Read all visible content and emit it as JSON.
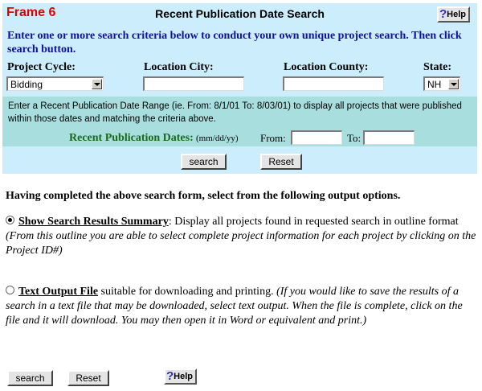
{
  "header": {
    "frame_label": "Frame 6",
    "title": "Recent Publication Date Search",
    "help_label": "Help",
    "help_icon": "question-mark-icon"
  },
  "search": {
    "instructions": "Enter one or more search criteria below to conduct your own unique project search. Then click search button.",
    "project_cycle_label": "Project Cycle:",
    "project_cycle_value": "Bidding",
    "location_city_label": "Location City:",
    "location_city_value": "",
    "location_county_label": "Location County:",
    "location_county_value": "",
    "state_label": "State:",
    "state_value": "NH",
    "date_range_instructions": "Enter a Recent Publication Date Range (ie. From: 8/1/01 To: 8/03/01) to display all projects that were published within those dates and matching the criteria above.",
    "recent_dates_label": "Recent Publication Dates:",
    "date_format": "(mm/dd/yy)",
    "from_label": "From:",
    "from_value": "",
    "to_label": "To:",
    "to_value": "",
    "search_button": "search",
    "reset_button": "Reset"
  },
  "output": {
    "heading": "Having completed the above search form, select from the following output options.",
    "summary_label": "Show Search Results Summary",
    "summary_desc": ": Display all projects found in requested search in outline format",
    "summary_note": "(From this outline you are able to select complete project information for each project by clicking on the Project ID#)",
    "summary_selected": true,
    "text_label": "Text Output File",
    "text_desc": " suitable for downloading and printing. ",
    "text_note": "(If you would like to save the results of a search in a text file that may be downloaded, select text output.  When the file is complete, click on the file and it will download.  You may then open it in Word or equivalent and print.)",
    "text_selected": false
  },
  "footer": {
    "search_button": "search",
    "reset_button": "Reset",
    "help_label": "Help"
  },
  "colors": {
    "panel_bg": "#cceefc",
    "date_bg": "#a8dede",
    "frame_label": "#e00000",
    "instructions": "#1010a0",
    "dates_label": "#1a6a1a"
  }
}
